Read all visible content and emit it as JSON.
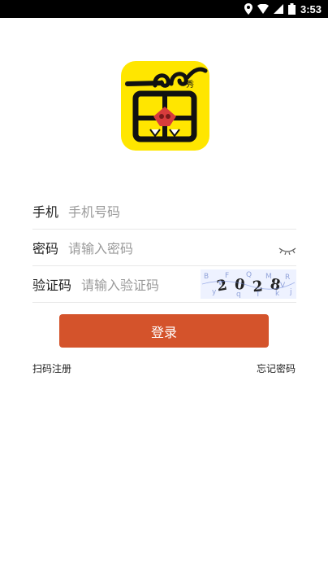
{
  "status": {
    "time": "3:53"
  },
  "form": {
    "phone": {
      "label": "手机",
      "placeholder": "手机号码"
    },
    "password": {
      "label": "密码",
      "placeholder": "请输入密码"
    },
    "captcha": {
      "label": "验证码",
      "placeholder": "请输入验证码",
      "code": "2028",
      "noise": "ByFqQTMkRjwV"
    }
  },
  "login_button": {
    "label": "登录"
  },
  "links": {
    "register": "扫码注册",
    "forgot": "忘记密码"
  },
  "colors": {
    "primary": "#D4532B",
    "logo_bg": "#FFE600"
  }
}
